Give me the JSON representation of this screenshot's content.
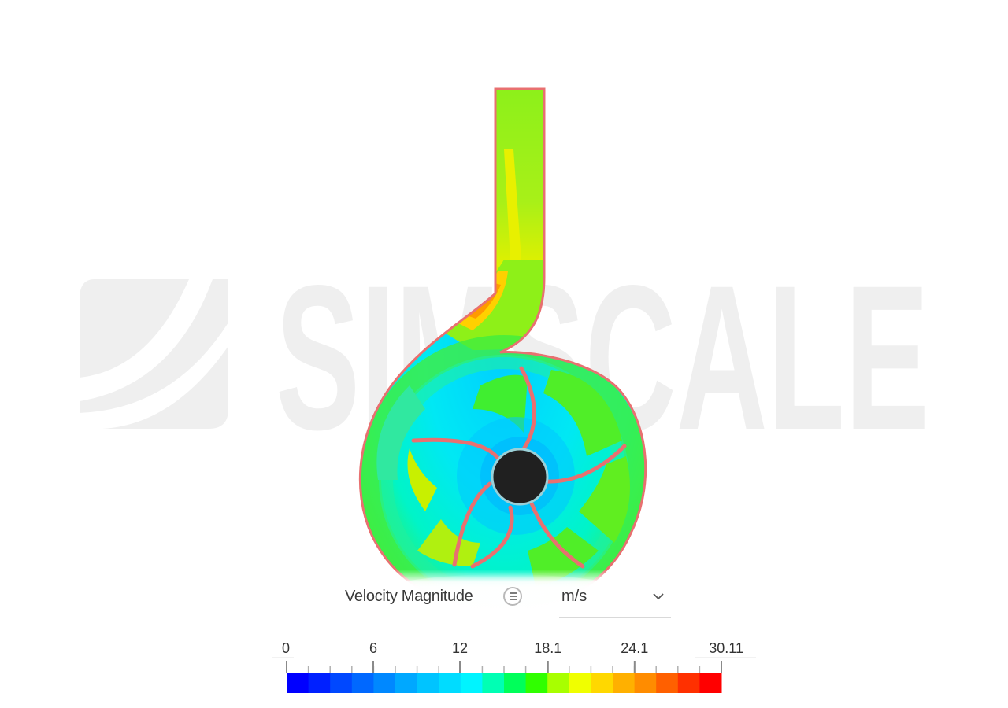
{
  "legend": {
    "quantity": "Velocity Magnitude",
    "unit": "m/s",
    "menu_icon": "list-menu-icon",
    "dropdown_icon": "chevron-down-icon",
    "min": 0,
    "max": 30.11,
    "tick_labels": [
      "0",
      "6",
      "12",
      "18.1",
      "24.1",
      "30.11"
    ],
    "tick_values": [
      0,
      6,
      12,
      18.1,
      24.1,
      30.11
    ],
    "colors": [
      "#0000ff",
      "#0020ff",
      "#0048ff",
      "#0068ff",
      "#0088ff",
      "#00a8ff",
      "#00c4ff",
      "#00dcff",
      "#00f4ff",
      "#00ffb4",
      "#00ff5a",
      "#30ff00",
      "#a8ff00",
      "#f0ff00",
      "#ffd800",
      "#ffb000",
      "#ff8c00",
      "#ff6000",
      "#ff3000",
      "#ff0000"
    ]
  },
  "watermark": {
    "text": "SIMSCALE",
    "color": "#efefef"
  },
  "impeller": {
    "blade_count": 6
  }
}
